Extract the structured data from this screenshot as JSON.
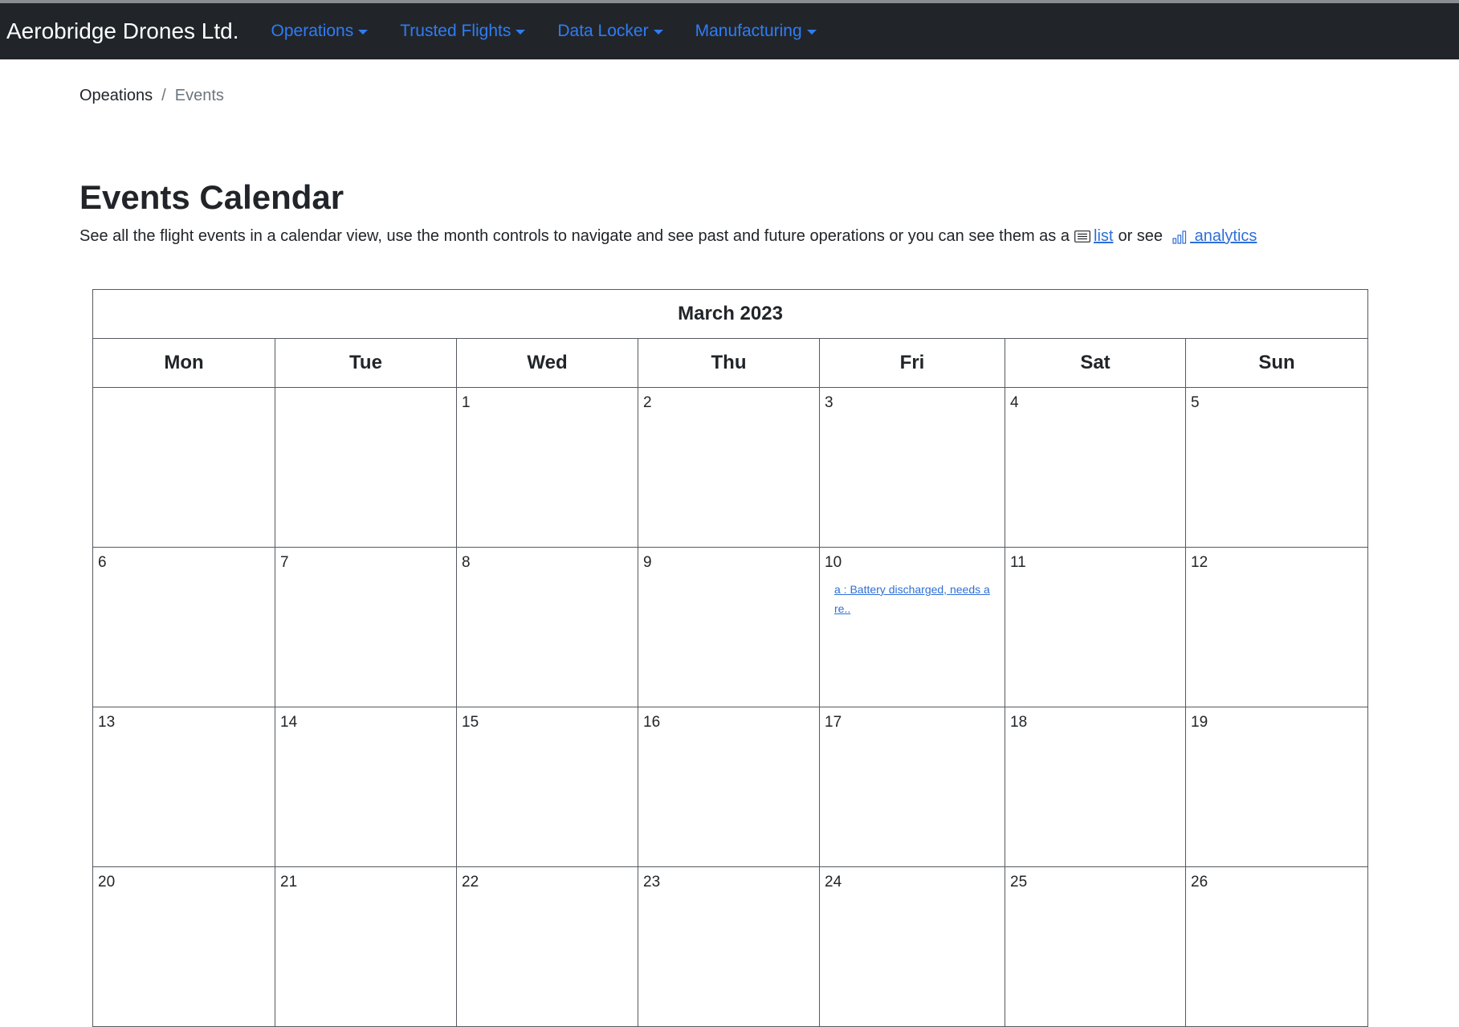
{
  "navbar": {
    "brand": "Aerobridge Drones Ltd.",
    "items": [
      {
        "label": "Operations"
      },
      {
        "label": "Trusted Flights"
      },
      {
        "label": "Data Locker"
      },
      {
        "label": "Manufacturing"
      }
    ]
  },
  "breadcrumb": {
    "parent": "Opeations",
    "separator": "/",
    "current": "Events"
  },
  "page": {
    "title": "Events Calendar",
    "intro_text": "See all the flight events in a calendar view, use the month controls to navigate and see past and future operations or you can see them as a",
    "list_link": "list",
    "middle_text": "or see",
    "analytics_link": " analytics",
    "list_icon": "list-icon",
    "analytics_icon": "bar-chart-icon"
  },
  "calendar": {
    "month_label": "March 2023",
    "weekdays": [
      "Mon",
      "Tue",
      "Wed",
      "Thu",
      "Fri",
      "Sat",
      "Sun"
    ],
    "weeks": [
      [
        {
          "day": ""
        },
        {
          "day": ""
        },
        {
          "day": "1"
        },
        {
          "day": "2"
        },
        {
          "day": "3"
        },
        {
          "day": "4"
        },
        {
          "day": "5"
        }
      ],
      [
        {
          "day": "6"
        },
        {
          "day": "7"
        },
        {
          "day": "8"
        },
        {
          "day": "9"
        },
        {
          "day": "10",
          "event": "a : Battery discharged, needs a re.."
        },
        {
          "day": "11"
        },
        {
          "day": "12"
        }
      ],
      [
        {
          "day": "13"
        },
        {
          "day": "14"
        },
        {
          "day": "15"
        },
        {
          "day": "16"
        },
        {
          "day": "17"
        },
        {
          "day": "18"
        },
        {
          "day": "19"
        }
      ],
      [
        {
          "day": "20"
        },
        {
          "day": "21"
        },
        {
          "day": "22"
        },
        {
          "day": "23"
        },
        {
          "day": "24"
        },
        {
          "day": "25"
        },
        {
          "day": "26"
        }
      ]
    ]
  },
  "colors": {
    "navbar_bg": "#212529",
    "nav_link": "#2f7cf6",
    "link": "#2f6fd6",
    "text": "#212529",
    "muted": "#6c757d"
  }
}
